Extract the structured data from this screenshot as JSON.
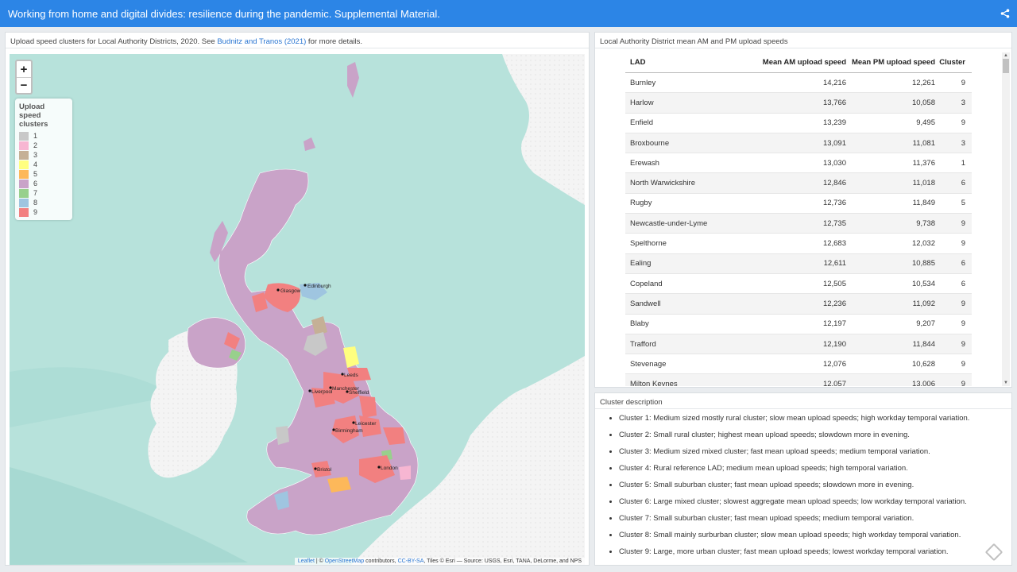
{
  "header": {
    "title": "Working from home and digital divides: resilience during the pandemic. Supplemental Material.",
    "share_icon": "share-icon"
  },
  "map_card": {
    "caption_pre": "Upload speed clusters for Local Authority Districts, 2020. See ",
    "caption_link": "Budnitz and Tranos (2021)",
    "caption_post": " for more details.",
    "zoom_in": "+",
    "zoom_out": "−",
    "legend_title": "Upload speed clusters",
    "legend": [
      {
        "label": "1",
        "color": "#c8c8c8"
      },
      {
        "label": "2",
        "color": "#f7b6d2"
      },
      {
        "label": "3",
        "color": "#c5b096"
      },
      {
        "label": "4",
        "color": "#ffff7f"
      },
      {
        "label": "5",
        "color": "#fdb85a"
      },
      {
        "label": "6",
        "color": "#c9a3c8"
      },
      {
        "label": "7",
        "color": "#98d08c"
      },
      {
        "label": "8",
        "color": "#9fc5e0"
      },
      {
        "label": "9",
        "color": "#f28080"
      }
    ],
    "cities": [
      "Glasgow",
      "Edinburgh",
      "Leeds",
      "Liverpool",
      "Manchester",
      "Sheffield",
      "Leicester",
      "Birmingham",
      "Bristol",
      "London"
    ],
    "attribution": {
      "leaflet": "Leaflet",
      "sep": " | © ",
      "osm": "OpenStreetMap",
      "contrib": " contributors, ",
      "license": "CC-BY-SA",
      "tiles": ", Tiles © Esri — Source: USGS, Esri, TANA, DeLorme, and NPS"
    }
  },
  "table_card": {
    "caption": "Local Authority District mean AM and PM upload speeds",
    "columns": [
      "LAD",
      "Mean AM upload speed",
      "Mean PM upload speed",
      "Cluster"
    ],
    "rows": [
      [
        "Burnley",
        "14,216",
        "12,261",
        "9"
      ],
      [
        "Harlow",
        "13,766",
        "10,058",
        "3"
      ],
      [
        "Enfield",
        "13,239",
        "9,495",
        "9"
      ],
      [
        "Broxbourne",
        "13,091",
        "11,081",
        "3"
      ],
      [
        "Erewash",
        "13,030",
        "11,376",
        "1"
      ],
      [
        "North Warwickshire",
        "12,846",
        "11,018",
        "6"
      ],
      [
        "Rugby",
        "12,736",
        "11,849",
        "5"
      ],
      [
        "Newcastle-under-Lyme",
        "12,735",
        "9,738",
        "9"
      ],
      [
        "Spelthorne",
        "12,683",
        "12,032",
        "9"
      ],
      [
        "Ealing",
        "12,611",
        "10,885",
        "6"
      ],
      [
        "Copeland",
        "12,505",
        "10,534",
        "6"
      ],
      [
        "Sandwell",
        "12,236",
        "11,092",
        "9"
      ],
      [
        "Blaby",
        "12,197",
        "9,207",
        "9"
      ],
      [
        "Trafford",
        "12,190",
        "11,844",
        "9"
      ],
      [
        "Stevenage",
        "12,076",
        "10,628",
        "9"
      ],
      [
        "Milton Keynes",
        "12,057",
        "13,006",
        "9"
      ]
    ]
  },
  "desc_card": {
    "caption": "Cluster description",
    "items": [
      "Cluster 1: Medium sized mostly rural cluster; slow mean upload speeds; high workday temporal variation.",
      "Cluster 2: Small rural cluster; highest mean upload speeds; slowdown more in evening.",
      "Cluster 3: Medium sized mixed cluster; fast mean upload speeds; medium temporal variation.",
      "Cluster 4: Rural reference LAD; medium mean upload speeds; high temporal variation.",
      "Cluster 5: Small suburban cluster; fast mean upload speeds; slowdown more in evening.",
      "Cluster 6: Large mixed cluster; slowest aggregate mean upload speeds; low workday temporal variation.",
      "Cluster 7: Small suburban cluster; fast mean upload speeds; medium temporal variation.",
      "Cluster 8: Small mainly surburban cluster; slow mean upload speeds; high workday temporal variation.",
      "Cluster 9: Large, more urban cluster; fast mean upload speeds; lowest workday temporal variation."
    ]
  }
}
